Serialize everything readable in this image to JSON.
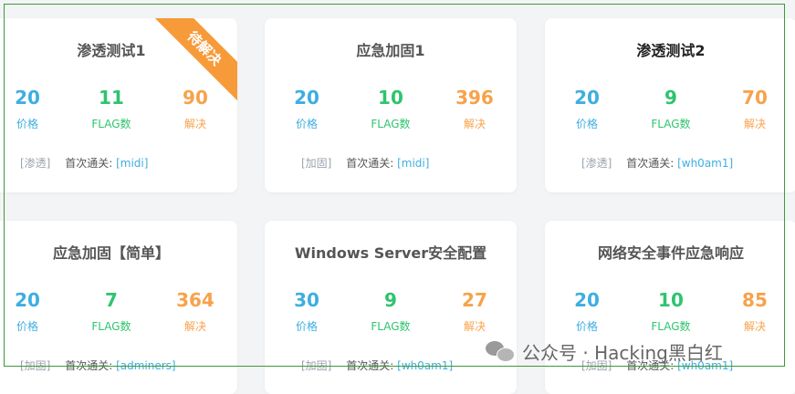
{
  "cards": [
    {
      "title": "渗透测试1",
      "ribbon": "待解决",
      "price": "20",
      "price_label": "价格",
      "flags": "11",
      "flags_label": "FLAG数",
      "solves": "90",
      "solves_label": "解决",
      "tag": "[渗透]",
      "first_blood_label": "首次通关:",
      "first_blood": "[midi]"
    },
    {
      "title": "应急加固1",
      "price": "20",
      "price_label": "价格",
      "flags": "10",
      "flags_label": "FLAG数",
      "solves": "396",
      "solves_label": "解决",
      "tag": "[加固]",
      "first_blood_label": "首次通关:",
      "first_blood": "[midi]"
    },
    {
      "title": "渗透测试2",
      "price": "20",
      "price_label": "价格",
      "flags": "9",
      "flags_label": "FLAG数",
      "solves": "70",
      "solves_label": "解决",
      "tag": "[渗透]",
      "first_blood_label": "首次通关:",
      "first_blood": "[wh0am1]"
    },
    {
      "title": "应急加固【简单】",
      "price": "20",
      "price_label": "价格",
      "flags": "7",
      "flags_label": "FLAG数",
      "solves": "364",
      "solves_label": "解决",
      "tag": "[加固]",
      "first_blood_label": "首次通关:",
      "first_blood": "[adminers]"
    },
    {
      "title": "Windows Server安全配置",
      "price": "30",
      "price_label": "价格",
      "flags": "9",
      "flags_label": "FLAG数",
      "solves": "27",
      "solves_label": "解决",
      "tag": "[加固]",
      "first_blood_label": "首次通关:",
      "first_blood": "[wh0am1]"
    },
    {
      "title": "网络安全事件应急响应",
      "price": "20",
      "price_label": "价格",
      "flags": "10",
      "flags_label": "FLAG数",
      "solves": "85",
      "solves_label": "解决",
      "tag": "[加固]",
      "first_blood_label": "首次通关:",
      "first_blood": "[wh0am1]"
    }
  ],
  "watermark": "公众号 · Hacking黑白红",
  "colors": {
    "price": "#3eaee1",
    "flags": "#2ec46e",
    "solves": "#f7a24b",
    "ribbon": "#f79a3a",
    "frame": "#3a9a3a"
  }
}
